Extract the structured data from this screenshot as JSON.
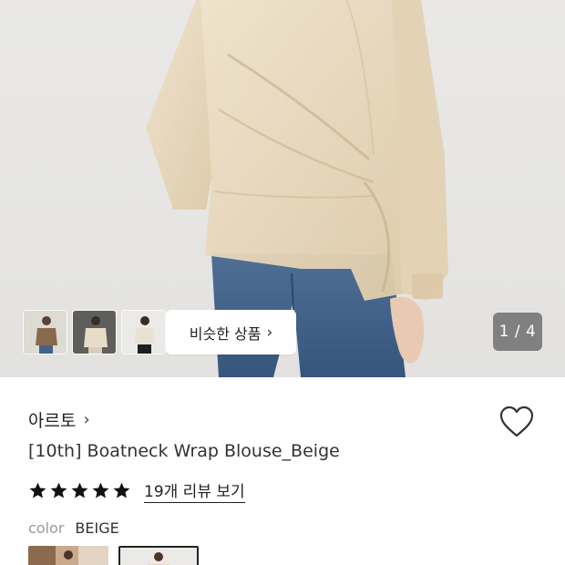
{
  "gallery": {
    "similar_button_label": "비슷한 상품",
    "counter": "1 / 4",
    "thumbnail_icons": [
      "model-photo-thumbnail-1",
      "model-photo-thumbnail-2",
      "model-photo-thumbnail-3"
    ]
  },
  "product": {
    "brand": "아르토",
    "title": "[10th] Boatneck Wrap Blouse_Beige",
    "rating_stars": 5,
    "review_link": "19개 리뷰 보기",
    "color_label": "color",
    "color_value": "BEIGE"
  },
  "colors": {
    "blouse": "#e8d9bf",
    "jeans": "#3f5f86",
    "accent_text": "#222222"
  }
}
